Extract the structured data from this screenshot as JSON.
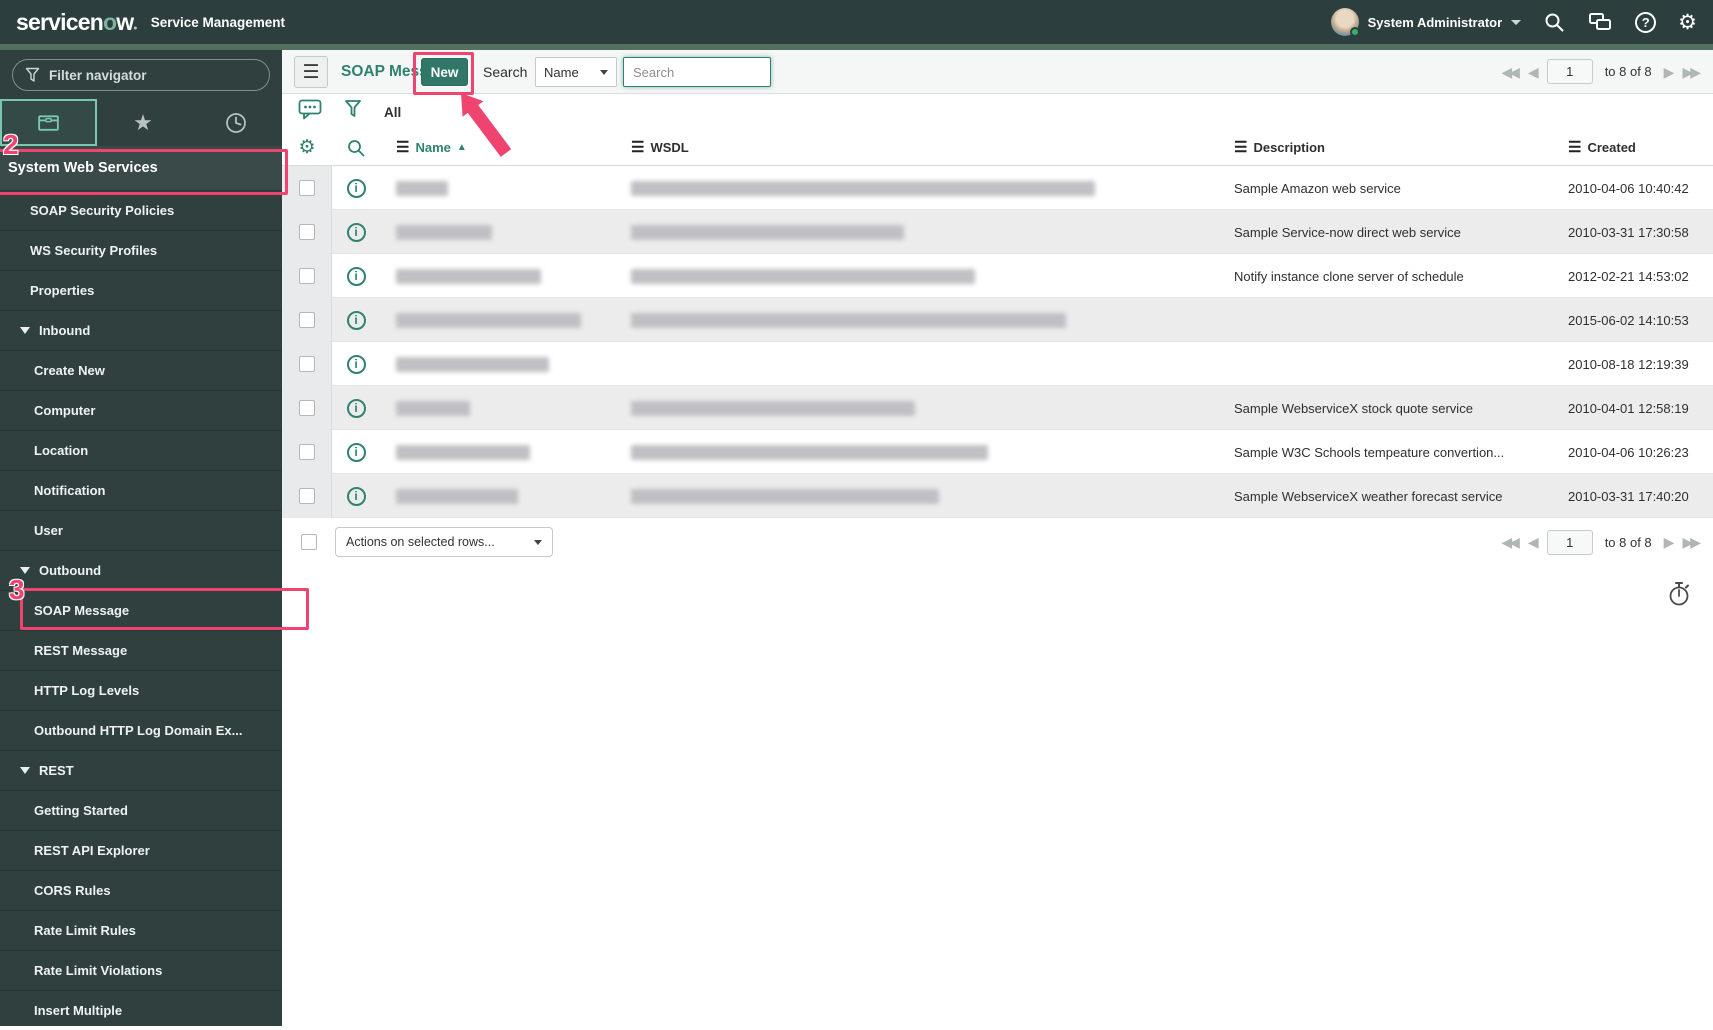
{
  "topbar": {
    "logo_prefix": "servicen",
    "logo_o": "o",
    "logo_suffix": "w",
    "product": "Service Management",
    "user": "System Administrator"
  },
  "sidebar": {
    "filter_placeholder": "Filter navigator",
    "section": "System Web Services",
    "items": [
      {
        "label": "SOAP Security Policies",
        "level": "top"
      },
      {
        "label": "WS Security Profiles",
        "level": "top"
      },
      {
        "label": "Properties",
        "level": "top"
      },
      {
        "label": "Inbound",
        "level": "expander"
      },
      {
        "label": "Create New",
        "level": "sub"
      },
      {
        "label": "Computer",
        "level": "sub"
      },
      {
        "label": "Location",
        "level": "sub"
      },
      {
        "label": "Notification",
        "level": "sub"
      },
      {
        "label": "User",
        "level": "sub"
      },
      {
        "label": "Outbound",
        "level": "expander"
      },
      {
        "label": "SOAP Message",
        "level": "sub"
      },
      {
        "label": "REST Message",
        "level": "sub"
      },
      {
        "label": "HTTP Log Levels",
        "level": "sub"
      },
      {
        "label": "Outbound HTTP Log Domain Ex...",
        "level": "sub"
      },
      {
        "label": "REST",
        "level": "expander"
      },
      {
        "label": "Getting Started",
        "level": "sub"
      },
      {
        "label": "REST API Explorer",
        "level": "sub"
      },
      {
        "label": "CORS Rules",
        "level": "sub"
      },
      {
        "label": "Rate Limit Rules",
        "level": "sub"
      },
      {
        "label": "Rate Limit Violations",
        "level": "sub"
      },
      {
        "label": "Insert Multiple",
        "level": "sub"
      }
    ]
  },
  "list": {
    "title": "SOAP Messages",
    "new_button": "New",
    "search_label": "Search",
    "search_column": "Name",
    "search_placeholder": "Search",
    "breadcrumb_all": "All",
    "actions_placeholder": "Actions on selected rows...",
    "pagination": {
      "page": "1",
      "range": "to 8 of 8"
    },
    "columns": {
      "name": "Name",
      "wsdl": "WSDL",
      "description": "Description",
      "created": "Created"
    },
    "sort": {
      "column": "Name",
      "direction": "asc",
      "arrow": "▲"
    },
    "rows": [
      {
        "name_redacted_w": 52,
        "wsdl_redacted_w": 464,
        "description": "Sample Amazon web service",
        "created": "2010-04-06 10:40:42"
      },
      {
        "name_redacted_w": 96,
        "wsdl_redacted_w": 273,
        "description": "Sample Service-now direct web service",
        "created": "2010-03-31 17:30:58"
      },
      {
        "name_redacted_w": 145,
        "wsdl_redacted_w": 344,
        "description": "Notify instance clone server of schedule",
        "created": "2012-02-21 14:53:02"
      },
      {
        "name_redacted_w": 185,
        "wsdl_redacted_w": 435,
        "description": "",
        "created": "2015-06-02 14:10:53"
      },
      {
        "name_redacted_w": 153,
        "wsdl_redacted_w": 0,
        "description": "",
        "created": "2010-08-18 12:19:39"
      },
      {
        "name_redacted_w": 74,
        "wsdl_redacted_w": 284,
        "description": "Sample WebserviceX stock quote service",
        "created": "2010-04-01 12:58:19"
      },
      {
        "name_redacted_w": 134,
        "wsdl_redacted_w": 357,
        "description": "Sample W3C Schools tempeature convertion...",
        "created": "2010-04-06 10:26:23"
      },
      {
        "name_redacted_w": 122,
        "wsdl_redacted_w": 308,
        "description": "Sample WebserviceX weather forecast service",
        "created": "2010-03-31 17:40:20"
      }
    ]
  },
  "annotations": {
    "step2": "2",
    "step3": "3"
  },
  "colors": {
    "accent": "#2e8270",
    "banner": "#2c3e3d",
    "annotation_pink": "#ef4370",
    "strip_green": "#52705f"
  }
}
